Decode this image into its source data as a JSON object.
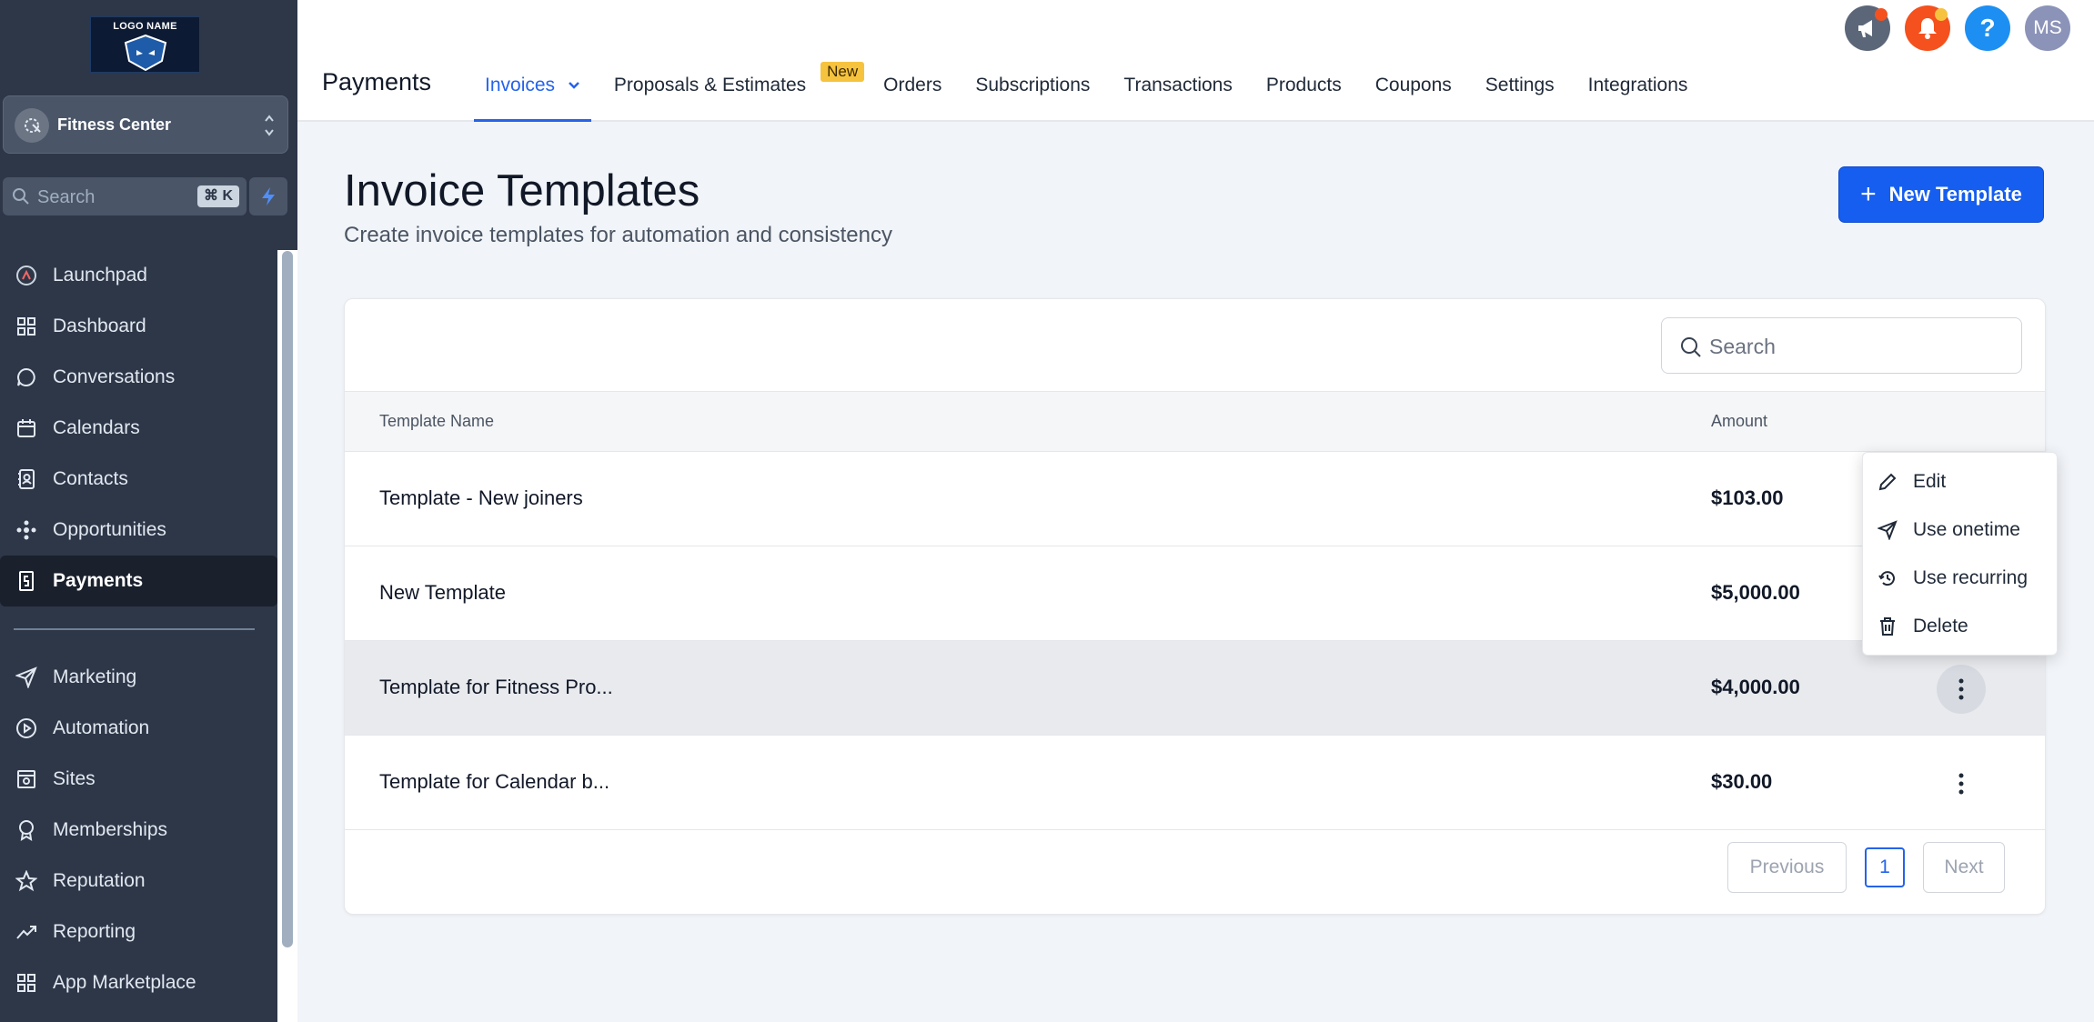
{
  "sidebar": {
    "logo_text": "LOGO NAME",
    "location": "Fitness Center",
    "search_placeholder": "Search",
    "search_shortcut": "⌘ K",
    "items": [
      {
        "label": "Launchpad",
        "icon": "launchpad-icon"
      },
      {
        "label": "Dashboard",
        "icon": "dashboard-icon"
      },
      {
        "label": "Conversations",
        "icon": "chat-icon"
      },
      {
        "label": "Calendars",
        "icon": "calendar-icon"
      },
      {
        "label": "Contacts",
        "icon": "contacts-icon"
      },
      {
        "label": "Opportunities",
        "icon": "opportunities-icon"
      },
      {
        "label": "Payments",
        "icon": "payments-icon",
        "active": true
      }
    ],
    "items2": [
      {
        "label": "Marketing",
        "icon": "send-icon"
      },
      {
        "label": "Automation",
        "icon": "automation-icon"
      },
      {
        "label": "Sites",
        "icon": "sites-icon"
      },
      {
        "label": "Memberships",
        "icon": "badge-icon"
      },
      {
        "label": "Reputation",
        "icon": "star-icon"
      },
      {
        "label": "Reporting",
        "icon": "trend-icon"
      },
      {
        "label": "App Marketplace",
        "icon": "grid-icon"
      }
    ]
  },
  "header": {
    "title": "Payments",
    "tabs": [
      {
        "label": "Invoices",
        "active": true
      },
      {
        "label": "Proposals & Estimates",
        "badge": "New"
      },
      {
        "label": "Orders"
      },
      {
        "label": "Subscriptions"
      },
      {
        "label": "Transactions"
      },
      {
        "label": "Products"
      },
      {
        "label": "Coupons"
      },
      {
        "label": "Settings"
      },
      {
        "label": "Integrations"
      }
    ],
    "avatar_initials": "MS"
  },
  "main": {
    "title": "Invoice Templates",
    "subtitle": "Create invoice templates for automation and consistency",
    "new_button": "New Template",
    "search_placeholder": "Search",
    "columns": [
      "Template Name",
      "Amount"
    ],
    "rows": [
      {
        "name": "Template - New joiners",
        "amount": "$103.00"
      },
      {
        "name": "New Template",
        "amount": "$5,000.00"
      },
      {
        "name": "Template for Fitness Pro...",
        "amount": "$4,000.00"
      },
      {
        "name": "Template for Calendar b...",
        "amount": "$30.00"
      }
    ],
    "pagination": {
      "prev": "Previous",
      "page": "1",
      "next": "Next"
    },
    "menu": [
      {
        "label": "Edit",
        "icon": "pencil-icon"
      },
      {
        "label": "Use onetime",
        "icon": "send-icon"
      },
      {
        "label": "Use recurring",
        "icon": "recurring-icon"
      },
      {
        "label": "Delete",
        "icon": "trash-icon"
      }
    ]
  },
  "colors": {
    "sidebar_bg": "#2d3748",
    "accent": "#155eef",
    "badge": "#f6c33e"
  }
}
